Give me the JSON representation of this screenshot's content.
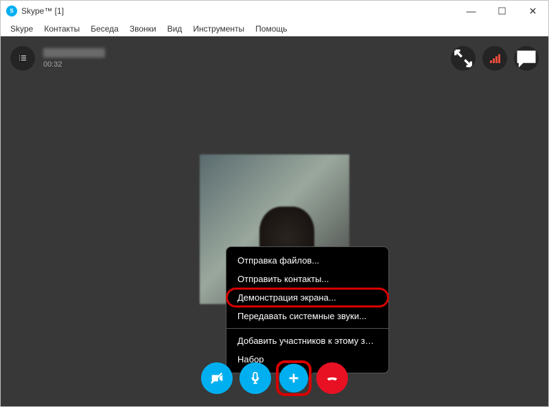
{
  "window": {
    "title": "Skype™ [1]"
  },
  "menu": {
    "items": [
      "Skype",
      "Контакты",
      "Беседа",
      "Звонки",
      "Вид",
      "Инструменты",
      "Помощь"
    ]
  },
  "call": {
    "timer": "00:32"
  },
  "popup": {
    "items": [
      {
        "label": "Отправка файлов...",
        "highlight": false
      },
      {
        "label": "Отправить контакты...",
        "highlight": false
      },
      {
        "label": "Демонстрация экрана...",
        "highlight": true
      },
      {
        "label": "Передавать системные звуки...",
        "highlight": false
      }
    ],
    "secondary": [
      {
        "label": "Добавить участников к этому звонку..."
      },
      {
        "label": "Набор"
      }
    ]
  },
  "icons": {
    "minimize": "—",
    "maximize": "☐",
    "close": "✕"
  }
}
